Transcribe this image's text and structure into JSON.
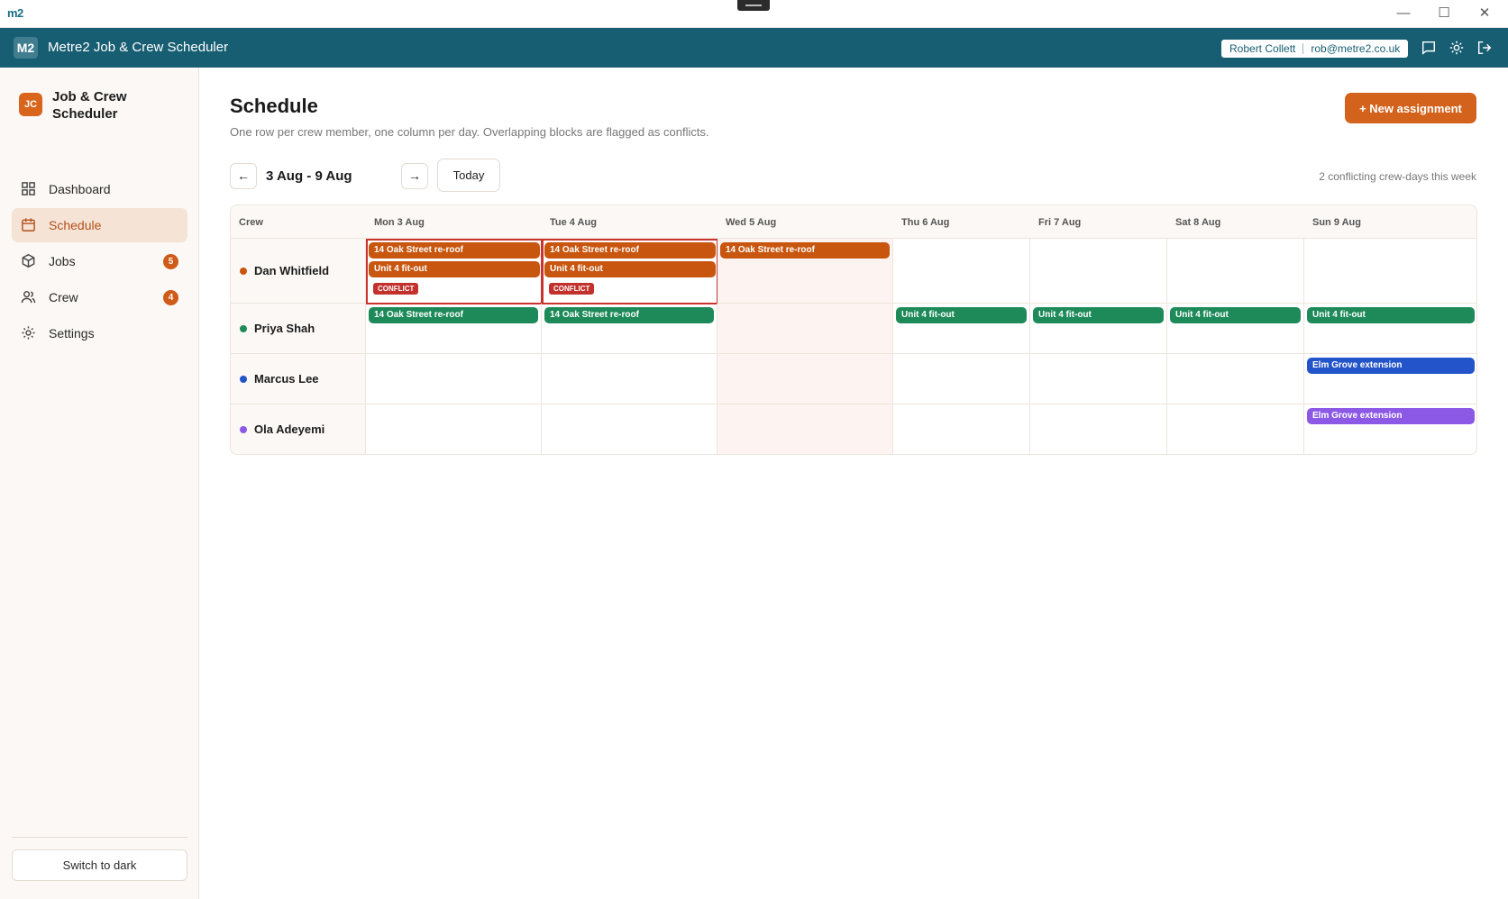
{
  "window": {
    "logo": "m2",
    "controls": {
      "minimize": "—",
      "maximize": "☐",
      "close": "✕"
    }
  },
  "header": {
    "mark": "M2",
    "title": "Metre2 Job & Crew Scheduler",
    "user_name": "Robert Collett",
    "user_email": "rob@metre2.co.uk",
    "icons": [
      "chat-icon",
      "gear-icon",
      "logout-icon"
    ]
  },
  "sidebar": {
    "badge": "JC",
    "brand": "Job & Crew Scheduler",
    "items": [
      {
        "label": "Dashboard",
        "icon": "dashboard-icon",
        "badge": null
      },
      {
        "label": "Schedule",
        "icon": "calendar-icon",
        "badge": null,
        "active": true
      },
      {
        "label": "Jobs",
        "icon": "box-icon",
        "badge": "5"
      },
      {
        "label": "Crew",
        "icon": "users-icon",
        "badge": "4"
      },
      {
        "label": "Settings",
        "icon": "gear-icon",
        "badge": null
      }
    ],
    "theme_toggle": "Switch to dark"
  },
  "main": {
    "title": "Schedule",
    "subtitle": "One row per crew member, one column per day. Overlapping blocks are flagged as conflicts.",
    "new_button": "+ New assignment",
    "week_label": "3 Aug - 9 Aug",
    "prev": "←",
    "next": "→",
    "today_button": "Today",
    "conflict_summary": "2 conflicting crew-days this week"
  },
  "colors": {
    "orange": "#c8560f",
    "green": "#1e8a5a",
    "blue": "#2354c9",
    "purple": "#8b59e6",
    "conflict": "#c9342f"
  },
  "grid": {
    "crew_header": "Crew",
    "days": [
      "Mon 3 Aug",
      "Tue 4 Aug",
      "Wed 5 Aug",
      "Thu 6 Aug",
      "Fri 7 Aug",
      "Sat 8 Aug",
      "Sun 9 Aug"
    ],
    "today_index": 2,
    "conflict_label": "CONFLICT",
    "crew": [
      {
        "name": "Dan Whitfield",
        "color": "#c8560f",
        "days": [
          {
            "blocks": [
              "14 Oak Street re-roof",
              "Unit 4 fit-out"
            ],
            "conflict": true
          },
          {
            "blocks": [
              "14 Oak Street re-roof",
              "Unit 4 fit-out"
            ],
            "conflict": true
          },
          {
            "blocks": [
              "14 Oak Street re-roof"
            ]
          },
          {
            "blocks": []
          },
          {
            "blocks": []
          },
          {
            "blocks": []
          },
          {
            "blocks": []
          }
        ]
      },
      {
        "name": "Priya Shah",
        "color": "#1e8a5a",
        "days": [
          {
            "blocks": [
              "14 Oak Street re-roof"
            ]
          },
          {
            "blocks": [
              "14 Oak Street re-roof"
            ]
          },
          {
            "blocks": []
          },
          {
            "blocks": [
              "Unit 4 fit-out"
            ]
          },
          {
            "blocks": [
              "Unit 4 fit-out"
            ]
          },
          {
            "blocks": [
              "Unit 4 fit-out"
            ]
          },
          {
            "blocks": [
              "Unit 4 fit-out"
            ]
          }
        ]
      },
      {
        "name": "Marcus Lee",
        "color": "#2354c9",
        "days": [
          {
            "blocks": []
          },
          {
            "blocks": []
          },
          {
            "blocks": []
          },
          {
            "blocks": []
          },
          {
            "blocks": []
          },
          {
            "blocks": []
          },
          {
            "blocks": [
              "Elm Grove extension"
            ]
          }
        ]
      },
      {
        "name": "Ola Adeyemi",
        "color": "#8b59e6",
        "days": [
          {
            "blocks": []
          },
          {
            "blocks": []
          },
          {
            "blocks": []
          },
          {
            "blocks": []
          },
          {
            "blocks": []
          },
          {
            "blocks": []
          },
          {
            "blocks": [
              "Elm Grove extension"
            ]
          }
        ]
      }
    ]
  }
}
